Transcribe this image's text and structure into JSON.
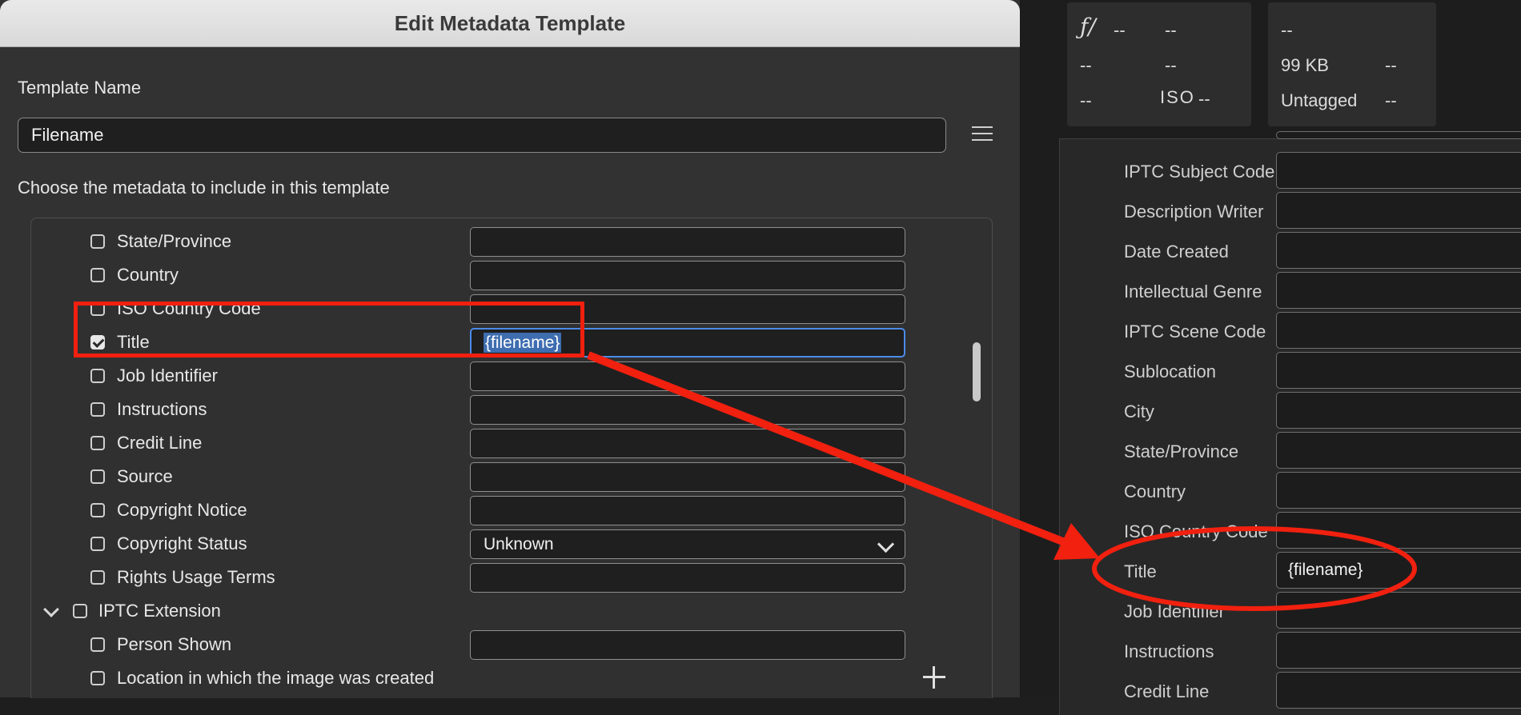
{
  "dialog": {
    "title": "Edit Metadata Template",
    "template_name_label": "Template Name",
    "template_name_value": "Filename",
    "choose_label": "Choose the metadata to include in this template",
    "rows": [
      {
        "label": "State/Province",
        "checked": false,
        "field": ""
      },
      {
        "label": "Country",
        "checked": false,
        "field": ""
      },
      {
        "label": "ISO Country Code",
        "checked": false,
        "field": ""
      },
      {
        "label": "Title",
        "checked": true,
        "field": "{filename}"
      },
      {
        "label": "Job Identifier",
        "checked": false,
        "field": ""
      },
      {
        "label": "Instructions",
        "checked": false,
        "field": ""
      },
      {
        "label": "Credit Line",
        "checked": false,
        "field": ""
      },
      {
        "label": "Source",
        "checked": false,
        "field": ""
      },
      {
        "label": "Copyright Notice",
        "checked": false,
        "field": ""
      },
      {
        "label": "Copyright Status",
        "checked": false,
        "field": "Unknown"
      },
      {
        "label": "Rights Usage Terms",
        "checked": false,
        "field": ""
      }
    ],
    "group": {
      "label": "IPTC Extension",
      "checked": false
    },
    "group_rows": [
      {
        "label": "Person Shown",
        "checked": false,
        "field": ""
      },
      {
        "label": "Location in which the image was created",
        "checked": false
      }
    ]
  },
  "info": {
    "aperture_symbol": "ƒ/",
    "aperture": "--",
    "shutter": "--",
    "row2_a": "--",
    "row2_b": "--",
    "row3_a": "--",
    "iso_label": "ISO",
    "iso_value": "--",
    "col2_r1_a": "--",
    "file_size": "99 KB",
    "col2_r2_b": "--",
    "tag_status": "Untagged",
    "col2_r3_b": "--"
  },
  "metadata_panel": {
    "rows": [
      {
        "label": "IPTC Subject Code",
        "value": ""
      },
      {
        "label": "Description Writer",
        "value": ""
      },
      {
        "label": "Date Created",
        "value": ""
      },
      {
        "label": "Intellectual Genre",
        "value": ""
      },
      {
        "label": "IPTC Scene Code",
        "value": ""
      },
      {
        "label": "Sublocation",
        "value": ""
      },
      {
        "label": "City",
        "value": ""
      },
      {
        "label": "State/Province",
        "value": ""
      },
      {
        "label": "Country",
        "value": ""
      },
      {
        "label": "ISO Country Code",
        "value": ""
      },
      {
        "label": "Title",
        "value": "{filename}"
      },
      {
        "label": "Job Identifier",
        "value": ""
      },
      {
        "label": "Instructions",
        "value": ""
      },
      {
        "label": "Credit Line",
        "value": ""
      }
    ]
  },
  "colors": {
    "annotation": "#f1200f",
    "focus": "#4b8be8",
    "selection": "#3e6db0"
  }
}
